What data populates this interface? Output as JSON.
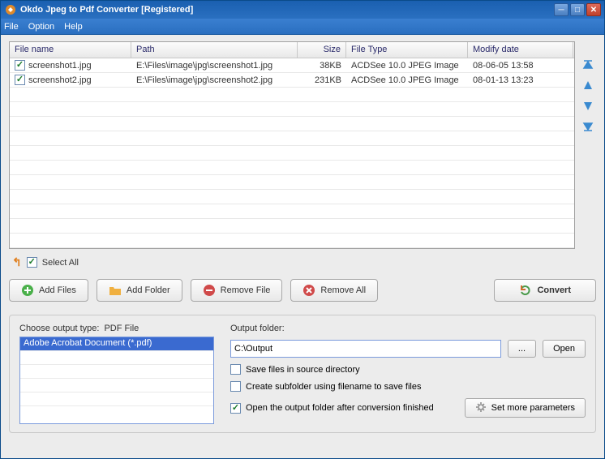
{
  "window": {
    "title": "Okdo Jpeg to Pdf Converter [Registered]"
  },
  "menu": {
    "file": "File",
    "option": "Option",
    "help": "Help"
  },
  "table": {
    "headers": {
      "name": "File name",
      "path": "Path",
      "size": "Size",
      "type": "File Type",
      "date": "Modify date"
    },
    "rows": [
      {
        "checked": true,
        "name": "screenshot1.jpg",
        "path": "E:\\Files\\image\\jpg\\screenshot1.jpg",
        "size": "38KB",
        "type": "ACDSee 10.0 JPEG Image",
        "date": "08-06-05 13:58"
      },
      {
        "checked": true,
        "name": "screenshot2.jpg",
        "path": "E:\\Files\\image\\jpg\\screenshot2.jpg",
        "size": "231KB",
        "type": "ACDSee 10.0 JPEG Image",
        "date": "08-01-13 13:23"
      }
    ]
  },
  "selectAll": {
    "label": "Select All",
    "checked": true
  },
  "buttons": {
    "addFiles": "Add Files",
    "addFolder": "Add Folder",
    "removeFile": "Remove File",
    "removeAll": "Remove All",
    "convert": "Convert"
  },
  "output": {
    "chooseTypeLabel": "Choose output type:",
    "typeHeader": "PDF File",
    "options": [
      "Adobe Acrobat Document (*.pdf)"
    ],
    "folderLabel": "Output folder:",
    "folderValue": "C:\\Output",
    "browse": "...",
    "open": "Open",
    "saveInSource": {
      "label": "Save files in source directory",
      "checked": false
    },
    "createSubfolder": {
      "label": "Create subfolder using filename to save files",
      "checked": false
    },
    "openAfter": {
      "label": "Open the output folder after conversion finished",
      "checked": true
    },
    "moreParams": "Set more parameters"
  }
}
